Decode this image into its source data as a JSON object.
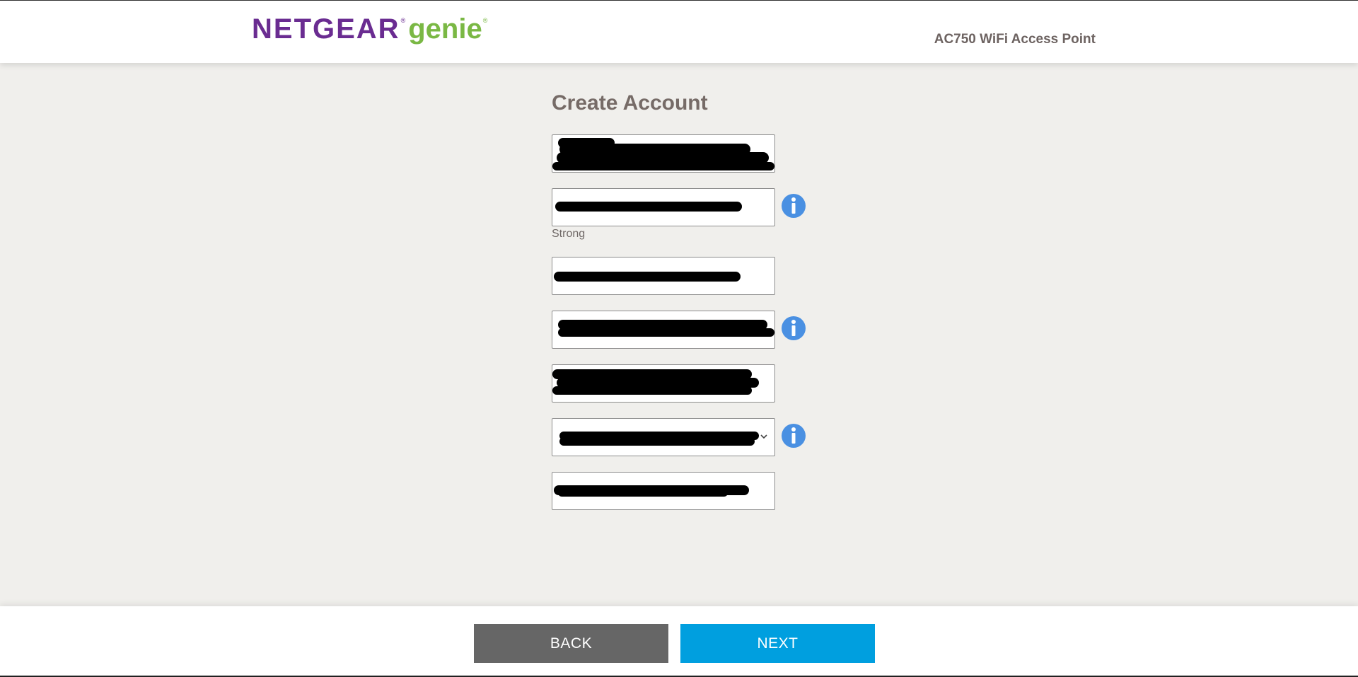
{
  "header": {
    "logo_brand": "NETGEAR",
    "logo_product": "genie",
    "logo_reg_mark": "®",
    "product_name": "AC750 WiFi Access Point"
  },
  "form": {
    "title": "Create Account",
    "fields": [
      {
        "name": "field-1",
        "value": ""
      },
      {
        "name": "field-2",
        "value": ""
      },
      {
        "name": "field-3",
        "value": ""
      },
      {
        "name": "field-4",
        "value": ""
      },
      {
        "name": "field-5",
        "value": ""
      },
      {
        "name": "field-6",
        "value": ""
      },
      {
        "name": "field-7",
        "value": ""
      }
    ],
    "password_strength": "Strong",
    "info_icon": "info-icon",
    "dropdown_icon": "chevron-down-icon"
  },
  "footer": {
    "back_label": "BACK",
    "next_label": "NEXT"
  },
  "colors": {
    "brand_purple": "#6a2c91",
    "brand_green": "#7ab844",
    "background": "#f0efec",
    "title_text": "#766b67",
    "back_button": "#666666",
    "next_button": "#009fdf",
    "info_icon": "#4a90e2"
  }
}
